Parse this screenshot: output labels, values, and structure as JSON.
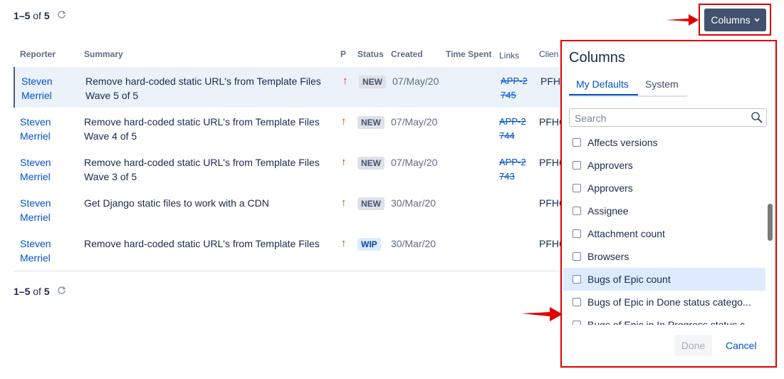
{
  "pager_top": {
    "range": "1–5",
    "of": "of",
    "total": "5"
  },
  "pager_bottom": {
    "range": "1–5",
    "of": "of",
    "total": "5"
  },
  "columns": {
    "reporter": "Reporter",
    "summary": "Summary",
    "p": "P",
    "status": "Status",
    "created": "Created",
    "time_spent": "Time Spent",
    "links": "Links",
    "client": "Clien"
  },
  "rows": [
    {
      "reporter": "Steven Merriel",
      "summary": "Remove hard-coded static URL's from Template Files Wave 5 of 5",
      "priority": "↑",
      "status": "NEW",
      "created": "07/May/20",
      "links": "APP-2745",
      "client": "PFHC"
    },
    {
      "reporter": "Steven Merriel",
      "summary": "Remove hard-coded static URL's from Template Files Wave 4 of 5",
      "priority": "↑",
      "status": "NEW",
      "created": "07/May/20",
      "links": "APP-2744",
      "client": "PFHC"
    },
    {
      "reporter": "Steven Merriel",
      "summary": "Remove hard-coded static URL's from Template Files Wave 3 of 5",
      "priority": "↑",
      "status": "NEW",
      "created": "07/May/20",
      "links": "APP-2743",
      "client": "PFHC"
    },
    {
      "reporter": "Steven Merriel",
      "summary": "Get Django static files to work with a CDN",
      "priority": "↑",
      "status": "NEW",
      "created": "30/Mar/20",
      "links": "",
      "client": "PFHC"
    },
    {
      "reporter": "Steven Merriel",
      "summary": "Remove hard-coded static URL's from Template Files",
      "priority": "↑",
      "status": "WIP",
      "created": "30/Mar/20",
      "links": "",
      "client": "PFHC"
    }
  ],
  "columns_button": {
    "label": "Columns",
    "chevron": "⌄"
  },
  "popup": {
    "title": "Columns",
    "tabs": [
      "My Defaults",
      "System"
    ],
    "search_placeholder": "Search",
    "options": [
      "Affects versions",
      "Approvers",
      "Approvers",
      "Assignee",
      "Attachment count",
      "Browsers",
      "Bugs of Epic count",
      "Bugs of Epic in Done status catego...",
      "Bugs of Epic in In Progress status c..."
    ],
    "done_label": "Done",
    "cancel_label": "Cancel"
  },
  "colors": {
    "accent": "#0052cc",
    "highlight": "#e00000",
    "priority": "#de350b",
    "button_bg": "#42526e"
  }
}
